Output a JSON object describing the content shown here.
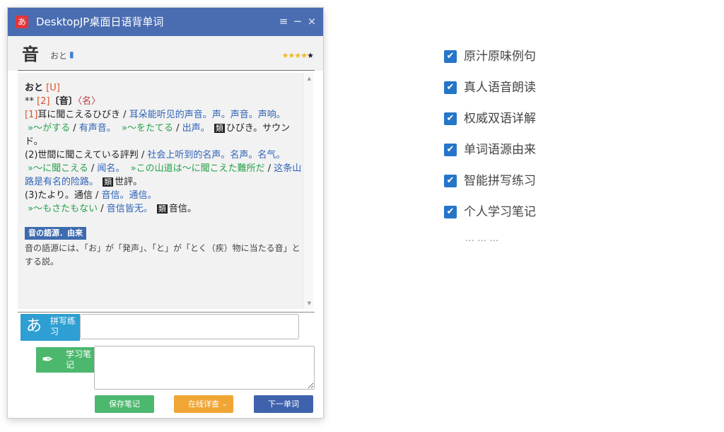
{
  "window": {
    "app_icon_text": "あ",
    "title": "DesktopJP桌面日语背单词",
    "controls": {
      "menu": "≡",
      "minimize": "−",
      "close": "×"
    }
  },
  "word_header": {
    "word": "音",
    "reading": "おと",
    "speaker_icon": "speaker-icon",
    "stars": {
      "filled": 4,
      "total": 5
    }
  },
  "entry": {
    "kana": "おと",
    "kana_tag": "[U]",
    "line2_prefix": "** ",
    "line2_tag": "[2]",
    "line2_bracket": "〔音〕",
    "line2_pos": "〈名〉",
    "sense1_num": "[1]",
    "sense1_jp": "耳に聞こえるひびき / ",
    "sense1_cn": "耳朵能听见的声音。声。声音。声响。",
    "ex1_jp": "»～がする",
    "ex1_sep": " / ",
    "ex1_cn": "有声音。",
    "ex2_jp": "»～をたてる",
    "ex2_sep": " / ",
    "ex2_cn": "出声。",
    "rel1_tag": "類",
    "rel1_text": "ひびき。サウンド。",
    "sense2_jp": "(2)世間に聞こえている評判 / ",
    "sense2_cn": "社会上听到的名声。名声。名气。",
    "ex3_jp": "»～に聞こえる",
    "ex3_sep": " / ",
    "ex3_cn": "闻名。",
    "ex4_jp": "»この山道は～に聞こえた難所だ",
    "ex4_sep": " / ",
    "ex4_cn": "这条山路是有名的险路。",
    "rel2_tag": "類",
    "rel2_text": "世評。",
    "sense3_jp": "(3)たより。通信 / ",
    "sense3_cn": "音信。通信。",
    "ex5_jp": "»～もさたもない",
    "ex5_sep": " / ",
    "ex5_cn": "音信皆无。",
    "rel3_tag": "類",
    "rel3_text": "音信。"
  },
  "etymology": {
    "title": "音の語源．由来",
    "text": "音の語源には、「お」が「発声」、「と」が「とく（疾）物に当たる音」とする説。"
  },
  "practice": {
    "spell_kana": "あ",
    "spell_label": "拼写练习",
    "spell_value": "",
    "note_icon": "quill-icon",
    "note_label": "学习笔记",
    "note_value": ""
  },
  "buttons": {
    "save": "保存笔记",
    "lookup": "在线详查",
    "lookup_chevron": "⌄",
    "next": "下一单词"
  },
  "features": [
    "原汁原味例句",
    "真人语音朗读",
    "权威双语详解",
    "单词语源由来",
    "智能拼写练习",
    "个人学习笔记"
  ],
  "features_more": "… … …",
  "colors": {
    "titlebar": "#4a6db2",
    "checkbox": "#2576c9",
    "save": "#4cb86e",
    "lookup": "#f0a535",
    "next": "#3f62ad"
  }
}
